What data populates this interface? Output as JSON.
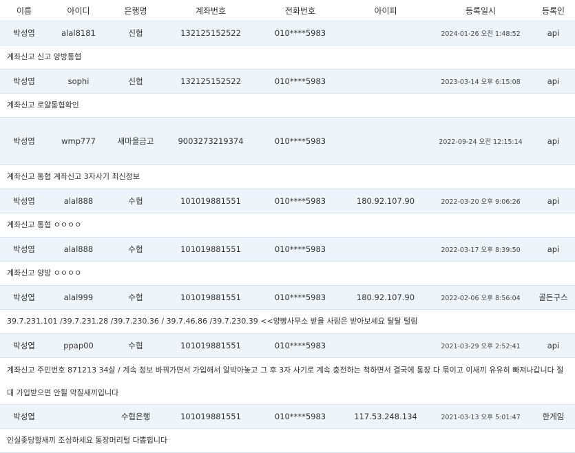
{
  "columns": [
    "이름",
    "아이디",
    "은행명",
    "계좌번호",
    "전화번호",
    "아이피",
    "등록일시",
    "등록인"
  ],
  "records": [
    {
      "name": "박성엽",
      "user_id": "alal8181",
      "bank": "신협",
      "account": "132125152522",
      "phone": "010****5983",
      "ip": "",
      "registered": "2024-01-26 오전 1:48:52",
      "registrant": "api",
      "memo": "계좌신고 신고 양방통협"
    },
    {
      "name": "박성엽",
      "user_id": "sophi",
      "bank": "신협",
      "account": "132125152522",
      "phone": "010****5983",
      "ip": "",
      "registered": "2023-03-14 오후 6:15:08",
      "registrant": "api",
      "memo": "계좌신고 로얄통협확인"
    },
    {
      "name": "박성엽",
      "user_id": "wmp777",
      "bank": "새마을금고",
      "account": "9003273219374",
      "phone": "010****5983",
      "ip": "",
      "registered": "2022-09-24 오전 12:15:14",
      "registrant": "api",
      "memo": "계좌신고 통협 계좌신고 3자사기 최신정보"
    },
    {
      "name": "박성엽",
      "user_id": "alal888",
      "bank": "수협",
      "account": "101019881551",
      "phone": "010****5983",
      "ip": "180.92.107.90",
      "registered": "2022-03-20 오후 9:06:26",
      "registrant": "api",
      "memo": "계좌신고 통협 ㅇㅇㅇㅇ"
    },
    {
      "name": "박성엽",
      "user_id": "alal888",
      "bank": "수협",
      "account": "101019881551",
      "phone": "010****5983",
      "ip": "",
      "registered": "2022-03-17 오후 8:39:50",
      "registrant": "api",
      "memo": "계좌신고 양방 ㅇㅇㅇㅇ"
    },
    {
      "name": "박성엽",
      "user_id": "alal999",
      "bank": "수협",
      "account": "101019881551",
      "phone": "010****5983",
      "ip": "180.92.107.90",
      "registered": "2022-02-06 오후 8:56:04",
      "registrant": "골든구스",
      "memo": "39.7.231.101 /39.7.231.28 /39.7.230.36 / 39.7.46.86 /39.7.230.39 <<양빵사무소 받을 사람은 받아보세요 탈탈 털림"
    },
    {
      "name": "박성엽",
      "user_id": "ppap00",
      "bank": "수협",
      "account": "101019881551",
      "phone": "010****5983",
      "ip": "",
      "registered": "2021-03-29 오후 2:52:41",
      "registrant": "api",
      "memo": "계좌신고 주민번호 871213 34살 / 계속 정보 바꿔가면서 가입해서 알박아놓고 그 후 3자 사기로 계속 충전하는 척하면서 결국에 통장 다 묶이고 이새끼 유유히 빠져나갑니다 절대 가입받으면 안될 악질새끼입니다"
    },
    {
      "name": "박성엽",
      "user_id": "",
      "bank": "수협은행",
      "account": "101019881551",
      "phone": "010****5983",
      "ip": "117.53.248.134",
      "registered": "2021-03-13 오후 5:01:47",
      "registrant": "한게임",
      "memo": "인실좆당할새끼 조심하세요 통장머리털 다뽑힙니다"
    }
  ]
}
